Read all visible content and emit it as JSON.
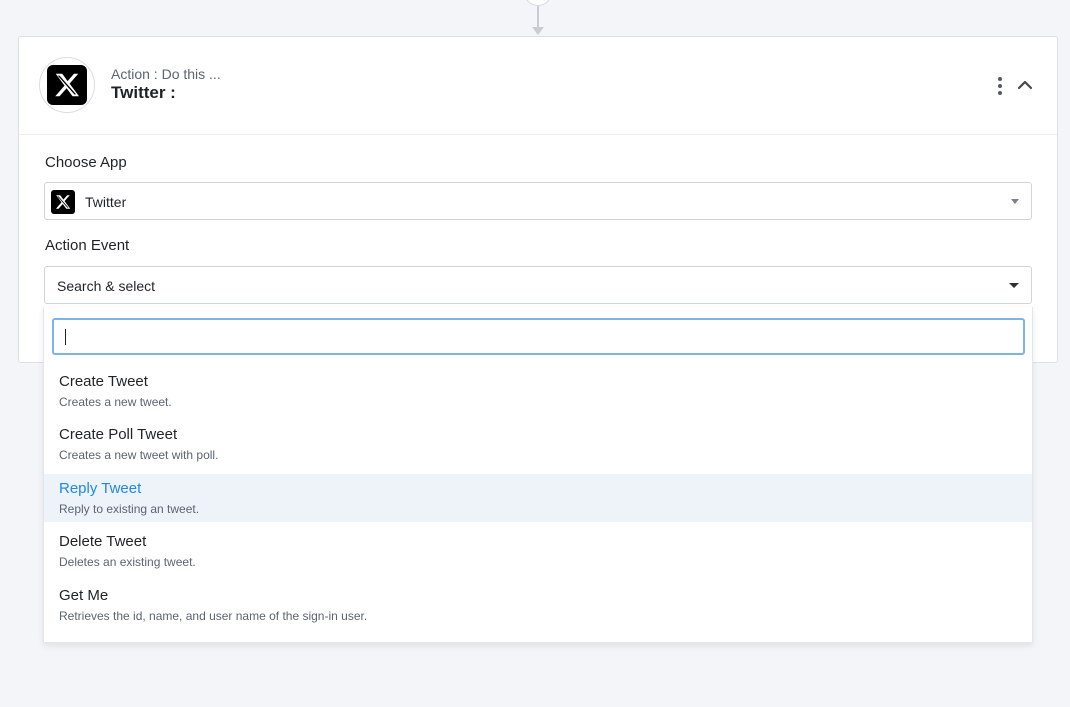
{
  "accent_color": "#1e88e5",
  "step": {
    "subtitle": "Action : Do this ...",
    "title": "Twitter :",
    "logo_icon": "x-logo-icon",
    "menu_icon": "kebab-menu-icon",
    "collapse_icon": "chevron-up-icon"
  },
  "choose_app": {
    "label": "Choose App",
    "value": "Twitter",
    "icon": "x-logo-icon"
  },
  "action_event": {
    "label": "Action Event",
    "placeholder": "Search & select",
    "search_value": ""
  },
  "options": [
    {
      "title": "Create Tweet",
      "description": "Creates a new tweet."
    },
    {
      "title": "Create Poll Tweet",
      "description": "Creates a new tweet with poll."
    },
    {
      "title": "Reply Tweet",
      "description": "Reply to existing an tweet.",
      "highlighted": true
    },
    {
      "title": "Delete Tweet",
      "description": "Deletes an existing tweet."
    },
    {
      "title": "Get Me",
      "description": "Retrieves the id, name, and user name of the sign-in user."
    }
  ]
}
